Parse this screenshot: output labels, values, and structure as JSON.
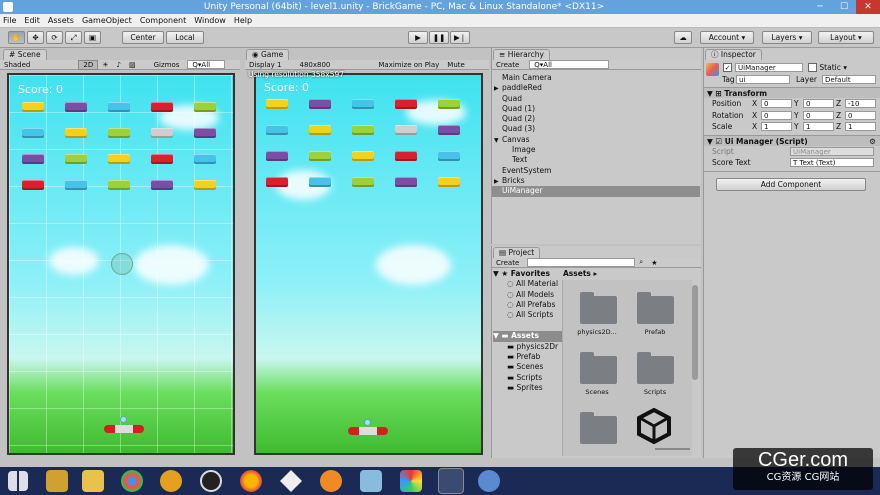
{
  "window": {
    "title": "Unity Personal (64bit) - level1.unity - BrickGame - PC, Mac & Linux Standalone* <DX11>"
  },
  "menu": [
    "File",
    "Edit",
    "Assets",
    "GameObject",
    "Component",
    "Window",
    "Help"
  ],
  "toolbar": {
    "center": "Center",
    "local": "Local",
    "account": "Account",
    "layers": "Layers",
    "layout": "Layout"
  },
  "scene": {
    "tab": "Scene",
    "shaded": "Shaded",
    "mode": "2D",
    "gizmos": "Gizmos",
    "search": "Q▾All",
    "score": "Score: 0"
  },
  "game": {
    "tab": "Game",
    "display": "Display 1",
    "resolution": "480x800",
    "maximize": "Maximize on Play",
    "mute": "Mute",
    "notice": "Using resolution 358x597",
    "score": "Score: 0"
  },
  "hierarchy": {
    "tab": "Hierarchy",
    "create": "Create",
    "search": "Q▾All",
    "items": [
      {
        "label": "Main Camera",
        "depth": 0,
        "arrow": ""
      },
      {
        "label": "paddleRed",
        "depth": 0,
        "arrow": "▶"
      },
      {
        "label": "Quad",
        "depth": 0,
        "arrow": ""
      },
      {
        "label": "Quad (1)",
        "depth": 0,
        "arrow": ""
      },
      {
        "label": "Quad (2)",
        "depth": 0,
        "arrow": ""
      },
      {
        "label": "Quad (3)",
        "depth": 0,
        "arrow": ""
      },
      {
        "label": "Canvas",
        "depth": 0,
        "arrow": "▼"
      },
      {
        "label": "Image",
        "depth": 1,
        "arrow": ""
      },
      {
        "label": "Text",
        "depth": 1,
        "arrow": ""
      },
      {
        "label": "EventSystem",
        "depth": 0,
        "arrow": ""
      },
      {
        "label": "Bricks",
        "depth": 0,
        "arrow": "▶"
      },
      {
        "label": "UiManager",
        "depth": 0,
        "arrow": "",
        "selected": true
      }
    ]
  },
  "project": {
    "tab": "Project",
    "create": "Create",
    "favorites": {
      "label": "Favorites",
      "items": [
        "All Material",
        "All Models",
        "All Prefabs",
        "All Scripts"
      ]
    },
    "assets": {
      "label": "Assets",
      "items": [
        "physics2Dr",
        "Prefab",
        "Scenes",
        "Scripts",
        "Sprites"
      ]
    },
    "breadcrumb": "Assets ▸",
    "grid": [
      {
        "label": "physics2D...",
        "kind": "folder"
      },
      {
        "label": "Prefab",
        "kind": "folder"
      },
      {
        "label": "Scenes",
        "kind": "folder"
      },
      {
        "label": "Scripts",
        "kind": "folder"
      },
      {
        "label": "",
        "kind": "folder"
      },
      {
        "label": "",
        "kind": "unity"
      }
    ]
  },
  "inspector": {
    "tab": "Inspector",
    "name": "UiManager",
    "static": "Static",
    "tag_label": "Tag",
    "tag": "ui",
    "layer_label": "Layer",
    "layer": "Default",
    "transform": {
      "header": "Transform",
      "rows": [
        {
          "label": "Position",
          "x": "0",
          "y": "0",
          "z": "-10"
        },
        {
          "label": "Rotation",
          "x": "0",
          "y": "0",
          "z": "0"
        },
        {
          "label": "Scale",
          "x": "1",
          "y": "1",
          "z": "1"
        }
      ]
    },
    "script": {
      "header": "Ui Manager (Script)",
      "script_label": "Script",
      "script_value": "UiManager",
      "score_label": "Score Text",
      "score_value": "Text (Text)"
    },
    "add_component": "Add Component"
  },
  "watermark": {
    "big": "CGer.com",
    "small": "CG资源 CG网站"
  },
  "colors": {
    "yellow": "#f2d21c",
    "purple": "#7b4ea6",
    "blue": "#46c3e8",
    "red": "#d9202e",
    "green": "#9bd23b",
    "gray": "#cfcfcf"
  },
  "bricks": [
    [
      "yellow",
      "purple",
      "blue",
      "red",
      "green"
    ],
    [
      "blue",
      "yellow",
      "green",
      "gray",
      "purple"
    ],
    [
      "purple",
      "green",
      "yellow",
      "red",
      "blue"
    ],
    [
      "red",
      "blue",
      "green",
      "purple",
      "yellow"
    ]
  ]
}
